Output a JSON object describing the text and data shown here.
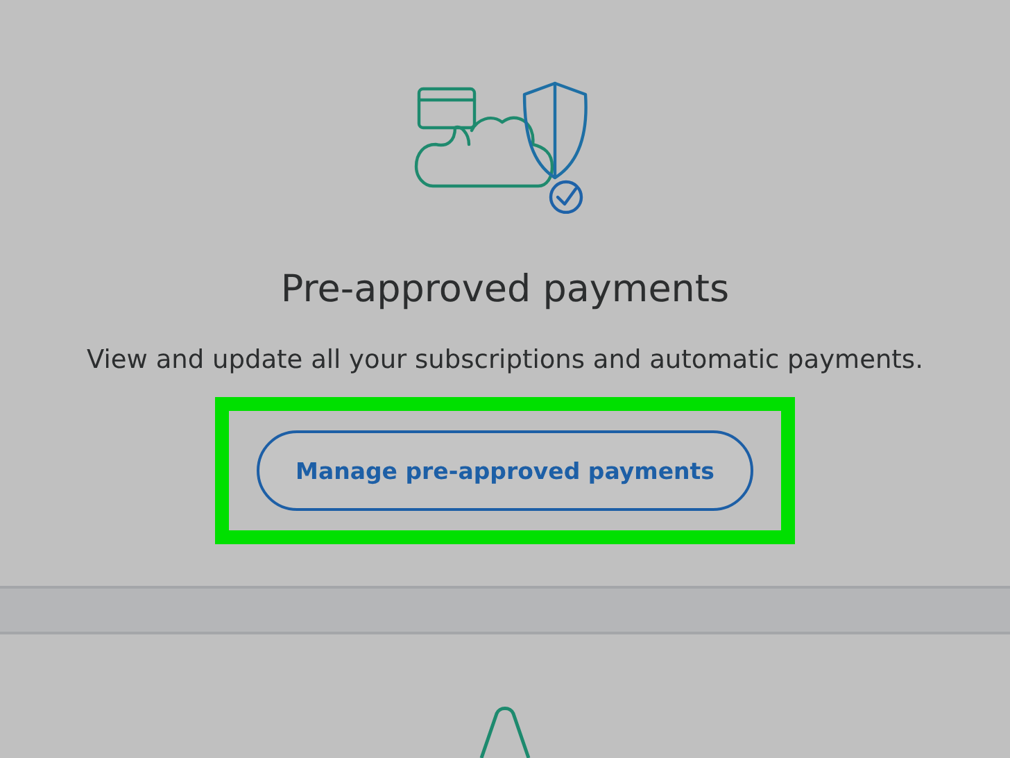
{
  "section": {
    "title": "Pre-approved payments",
    "description": "View and update all your subscriptions and automatic payments.",
    "button": {
      "label": "Manage pre-approved payments",
      "highlighted": true
    }
  }
}
